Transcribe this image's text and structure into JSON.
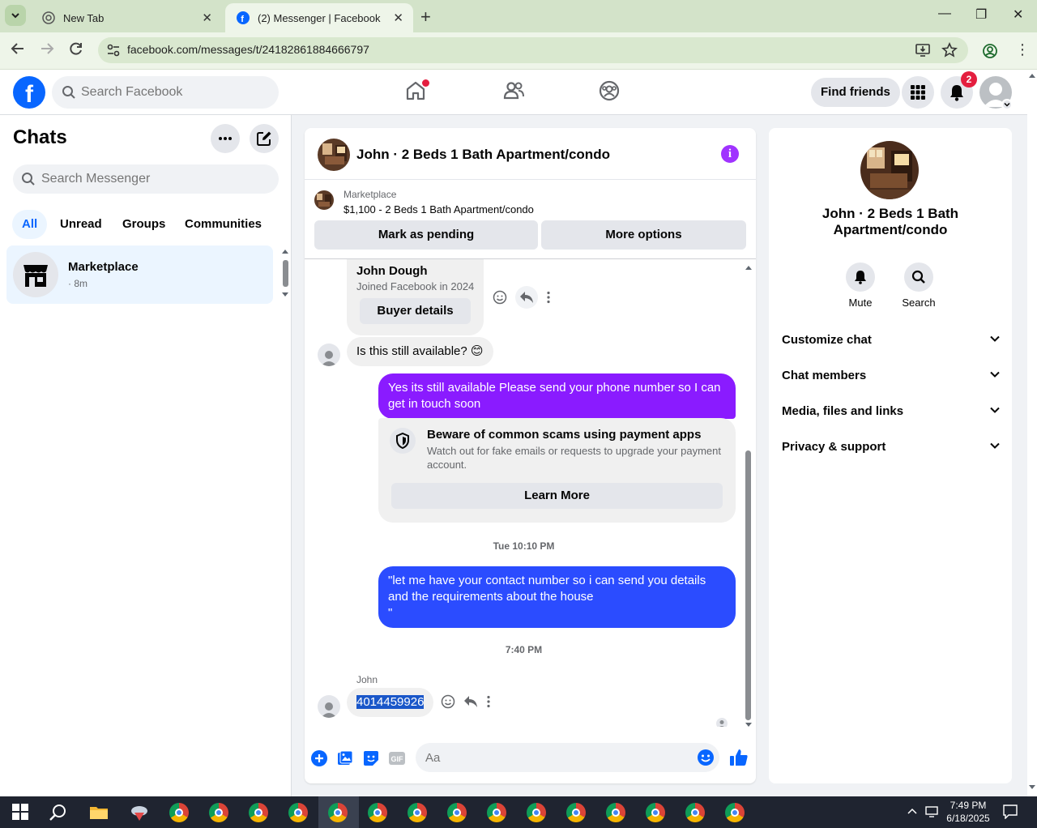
{
  "browser": {
    "tabs": [
      {
        "label": "New Tab",
        "active": false
      },
      {
        "label": "(2) Messenger | Facebook",
        "active": true
      }
    ],
    "url": "facebook.com/messages/t/24182861884666797"
  },
  "header": {
    "search_placeholder": "Search Facebook",
    "find_friends": "Find friends",
    "notification_count": "2"
  },
  "sidebar": {
    "title": "Chats",
    "search_placeholder": "Search Messenger",
    "filters": [
      "All",
      "Unread",
      "Groups",
      "Communities"
    ],
    "active_filter": "All",
    "chats": [
      {
        "name": "Marketplace",
        "subtitle": "· 8m"
      }
    ]
  },
  "conversation": {
    "title": "John · 2 Beds 1 Bath Apartment/condo",
    "listing": {
      "label": "Marketplace",
      "title": "$1,100 - 2 Beds 1 Bath Apartment/condo",
      "mark_pending": "Mark as pending",
      "more_options": "More options"
    },
    "buyer_card": {
      "name": "John Dough",
      "joined": "Joined Facebook in 2024",
      "button": "Buyer details"
    },
    "messages": [
      {
        "from": "them",
        "text": "Is this still available? 😊"
      },
      {
        "from": "me",
        "text": "Yes its still available Please send your phone number so I can get in touch soon"
      },
      {
        "from": "me",
        "text": "\"let me have your contact number so i can send you details and the requirements about the house\n\""
      },
      {
        "from": "them",
        "sender": "John",
        "text": "4014459926"
      }
    ],
    "scam_warning": {
      "title": "Beware of common scams using payment apps",
      "body": "Watch out for fake emails or requests to upgrade your payment account.",
      "button": "Learn More"
    },
    "timestamps": [
      "Tue 10:10 PM",
      "7:40 PM"
    ],
    "composer_placeholder": "Aa",
    "colors": {
      "purple": "#8a1bff",
      "blue": "#2b4cff",
      "accent": "#0866ff"
    }
  },
  "details": {
    "name": "John · 2 Beds 1 Bath Apartment/condo",
    "actions": [
      "Mute",
      "Search"
    ],
    "sections": [
      "Customize chat",
      "Chat members",
      "Media, files and links",
      "Privacy & support"
    ]
  },
  "taskbar": {
    "time": "7:49 PM",
    "date": "6/18/2025"
  }
}
